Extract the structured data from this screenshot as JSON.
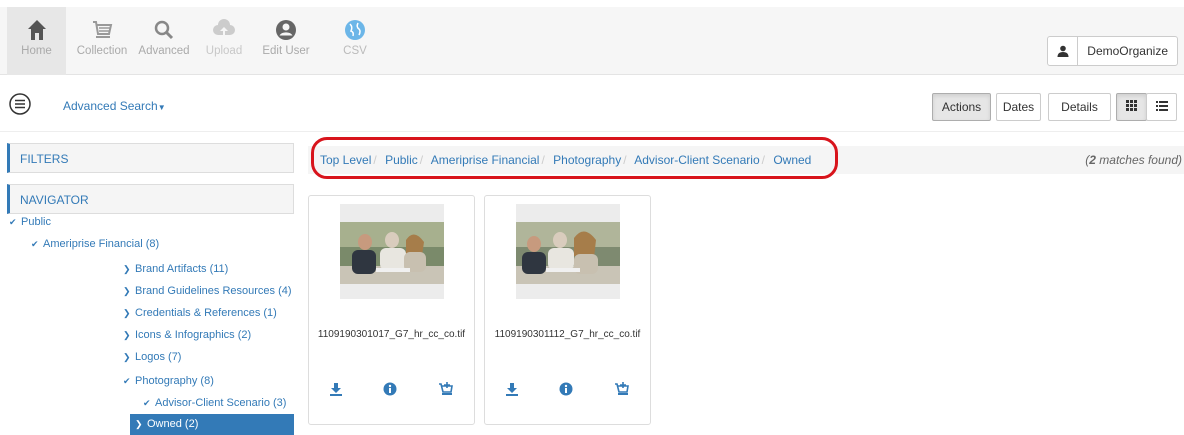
{
  "nav": {
    "items": [
      {
        "label": "Home",
        "icon": "home-icon"
      },
      {
        "label": "Collection",
        "icon": "cart-icon"
      },
      {
        "label": "Advanced",
        "icon": "search-icon"
      },
      {
        "label": "Upload",
        "icon": "upload-cloud-icon"
      },
      {
        "label": "Edit User",
        "icon": "user-circle-icon"
      },
      {
        "label": "CSV",
        "icon": "globe-icon"
      }
    ],
    "user_name": "DemoOrganize"
  },
  "toolbar": {
    "advanced_search": "Advanced Search",
    "actions": "Actions",
    "dates": "Dates",
    "details": "Details"
  },
  "sidebar": {
    "filters": "FILTERS",
    "navigator": "NAVIGATOR",
    "tree": [
      {
        "label": "Public"
      },
      {
        "label": "Ameriprise Financial (8)"
      },
      {
        "label": "Brand Artifacts (11)"
      },
      {
        "label": "Brand Guidelines Resources (4)"
      },
      {
        "label": "Credentials & References (1)"
      },
      {
        "label": "Icons & Infographics (2)"
      },
      {
        "label": "Logos (7)"
      },
      {
        "label": "Photography (8)"
      },
      {
        "label": "Advisor-Client Scenario (3)"
      },
      {
        "label": "Owned (2)"
      }
    ]
  },
  "breadcrumb": {
    "items": [
      "Top Level",
      "Public",
      "Ameriprise Financial",
      "Photography",
      "Advisor-Client Scenario",
      "Owned"
    ],
    "separator": "/",
    "match_count": "2",
    "match_text": " matches found)",
    "open_paren": "("
  },
  "results": [
    {
      "filename": "1109190301017_G7_hr_cc_co.tif"
    },
    {
      "filename": "1109190301112_G7_hr_cc_co.tif"
    }
  ],
  "colors": {
    "accent": "#337ab7",
    "highlight_oval": "#d8141c"
  }
}
